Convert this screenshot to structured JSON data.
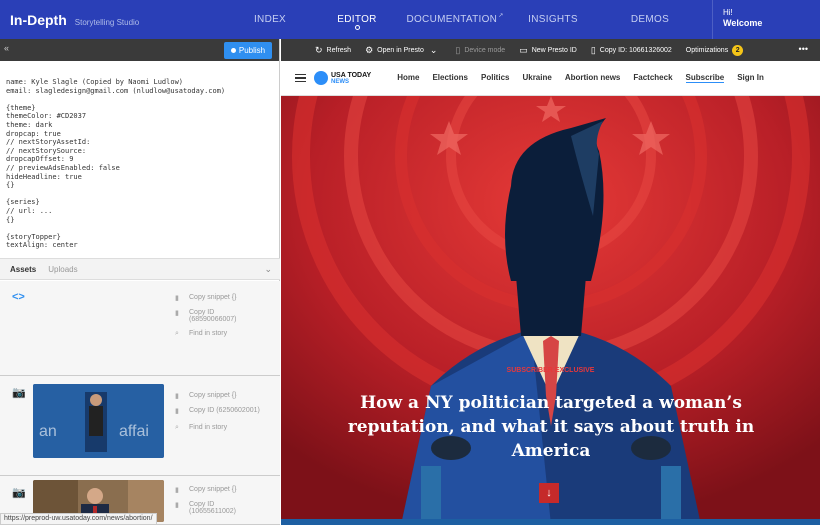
{
  "brand": {
    "name": "In-Depth",
    "tagline": "Storytelling Studio"
  },
  "nav": [
    {
      "label": "INDEX",
      "active": false
    },
    {
      "label": "EDITOR",
      "active": true
    },
    {
      "label": "DOCUMENTATION",
      "active": false,
      "external": true
    },
    {
      "label": "INSIGHTS",
      "active": false
    },
    {
      "label": "DEMOS",
      "active": false
    }
  ],
  "welcome": {
    "hi": "Hi!",
    "label": "Welcome"
  },
  "left_toolbar": {
    "publish_label": "Publish"
  },
  "code_lines": [
    "name: Kyle Slagle (Copied by Naomi Ludlow)",
    "email: slagledesign@gmail.com (nludlow@usatoday.com)",
    "",
    "{theme}",
    "themeColor: #CD2037",
    "theme: dark",
    "dropcap: true",
    "// nextStoryAssetId:",
    "// nextStorySource:",
    "dropcapOffset: 9",
    "// previewAdsEnabled: false",
    "hideHeadline: true",
    "{}",
    "",
    "{series}",
    "// url: ...",
    "{}",
    "",
    "{storyTopper}",
    "textAlign: center"
  ],
  "assets_tabs": {
    "assets": "Assets",
    "uploads": "Uploads"
  },
  "assets": [
    {
      "type": "code",
      "actions": [
        "Copy snippet {}",
        "Copy ID\n(68590066007)",
        "Find in story"
      ]
    },
    {
      "type": "image",
      "actions": [
        "Copy snippet {}",
        "Copy ID (6250602001)",
        "Find in story"
      ]
    },
    {
      "type": "image",
      "actions": [
        "Copy snippet {}",
        "Copy ID\n(10655611002)"
      ]
    }
  ],
  "status_url": "https://preprod-uw.usatoday.com/news/abortion/",
  "right_toolbar": {
    "refresh": "Refresh",
    "open_presto": "Open in Presto",
    "device_mode": "Device mode",
    "new_presto_id": "New Presto ID",
    "copy_id": "Copy ID: 10661326002",
    "optimizations": "Optimizations",
    "optimizations_count": "2"
  },
  "site": {
    "logo_line1": "USA TODAY",
    "logo_line2": "NEWS",
    "nav": [
      "Home",
      "Elections",
      "Politics",
      "Ukraine",
      "Abortion news",
      "Factcheck",
      "Subscribe",
      "Sign In"
    ]
  },
  "story": {
    "kicker": "SUBSCRIBER EXCLUSIVE",
    "headline": "How a NY politician targeted a woman’s reputation, and what it says about truth in America"
  },
  "colors": {
    "nav_blue": "#2a3fb7",
    "publish_blue": "#2f8ff0",
    "hero_red": "#c8272c",
    "usat_blue": "#2c8ef8"
  }
}
